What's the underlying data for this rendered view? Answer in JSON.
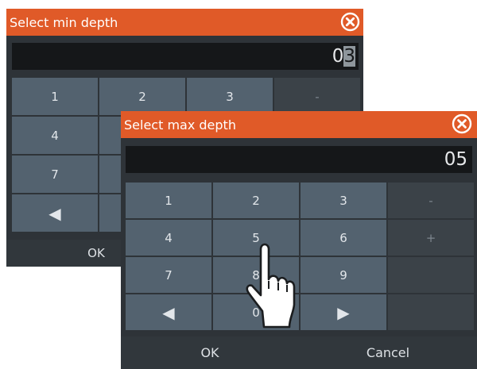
{
  "min_dialog": {
    "title": "Select min depth",
    "value_prefix": "0",
    "value_cursor": "3",
    "keys": [
      "1",
      "2",
      "3",
      "-",
      "4",
      "",
      "",
      "",
      "7",
      "",
      "",
      "",
      "◀",
      "",
      "",
      ""
    ],
    "ok_label": "OK"
  },
  "max_dialog": {
    "title": "Select max depth",
    "value": "05",
    "keys": [
      "1",
      "2",
      "3",
      "-",
      "4",
      "5",
      "6",
      "+",
      "7",
      "8",
      "9",
      "",
      "◀",
      "0",
      "▶",
      ""
    ],
    "ok_label": "OK",
    "cancel_label": "Cancel"
  },
  "colors": {
    "title_bar": "#e05a28",
    "panel": "#2e3338",
    "key": "#53626f",
    "display": "#151719"
  }
}
